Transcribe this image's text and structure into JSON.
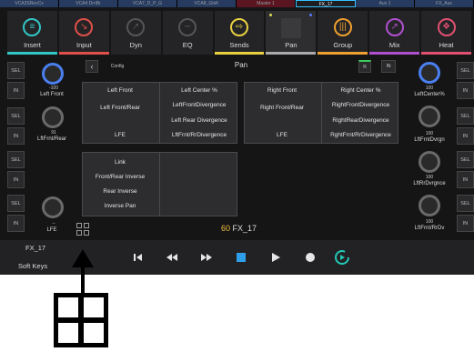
{
  "top_strip": [
    "VCA3SRevCx",
    "VCA4 DrnBr",
    "VCA7_D_P_G",
    "VCA8_GtsK",
    "Master 1",
    "FX_17",
    "Aux 1",
    "FX_Aux"
  ],
  "tabs": [
    {
      "label": "Insert",
      "icon": "list-icon",
      "color": "#32c5c5"
    },
    {
      "label": "Input",
      "icon": "input-icon",
      "color": "#e0504a"
    },
    {
      "label": "Dyn",
      "icon": "dynamics-icon",
      "color": "#666666"
    },
    {
      "label": "EQ",
      "icon": "eq-icon",
      "color": "#666666"
    },
    {
      "label": "Sends",
      "icon": "sends-icon",
      "color": "#e8d040"
    },
    {
      "label": "Pan",
      "icon": "pan-icon",
      "color": "#aaaaaa"
    },
    {
      "label": "Group",
      "icon": "group-icon",
      "color": "#f0a030"
    },
    {
      "label": "Mix",
      "icon": "mix-icon",
      "color": "#b050d0"
    },
    {
      "label": "Heat",
      "icon": "heat-icon",
      "color": "#e05070"
    }
  ],
  "header": {
    "title": "Pan",
    "back_icon": "chevron-left-icon",
    "config": "Config",
    "r_button": "R",
    "in_button": "IN"
  },
  "channels_left": [
    {
      "value": "-100",
      "label": "Left Front"
    },
    {
      "value": "91",
      "label": "LftFrnt/Rear"
    },
    {
      "value": "",
      "label": ""
    },
    {
      "value": "--",
      "label": "LFE"
    }
  ],
  "channels_right": [
    {
      "value": "100",
      "label": "LeftCenter%"
    },
    {
      "value": "100",
      "label": "LftFrntDvrgn"
    },
    {
      "value": "100",
      "label": "LftRrDvrgnce"
    },
    {
      "value": "100",
      "label": "LftFrnt/RrDv"
    }
  ],
  "buttons": {
    "sel": "SEL",
    "in": "IN"
  },
  "panel_left": {
    "col1": [
      "Left Front",
      "Left Front/Rear",
      "",
      "LFE"
    ],
    "col2": [
      "Left Center %",
      "LeftFrontDivergence",
      "Left Rear Divergence",
      "LftFrnt/RrDivergence"
    ]
  },
  "panel_right": {
    "col1": [
      "Right Front",
      "Right Front/Rear",
      "",
      "LFE"
    ],
    "col2": [
      "Right Center %",
      "RightFrontDivergence",
      "RightRearDivergence",
      "RghtFrnt/RrDivergence"
    ]
  },
  "panel_bottom": {
    "col1": [
      "Link",
      "Front/Rear Inverse",
      "Rear Inverse",
      "Inverse Pan"
    ]
  },
  "fx_display": {
    "number": "60",
    "name": "FX_17"
  },
  "bottom_left": {
    "name": "FX_17",
    "soft_keys": "Soft Keys"
  },
  "colors": {
    "accent_blue": "#4a7ff0",
    "fx_number": "#f0c040",
    "stop_blue": "#2f9ee8",
    "loop_teal": "#22c9b5"
  }
}
